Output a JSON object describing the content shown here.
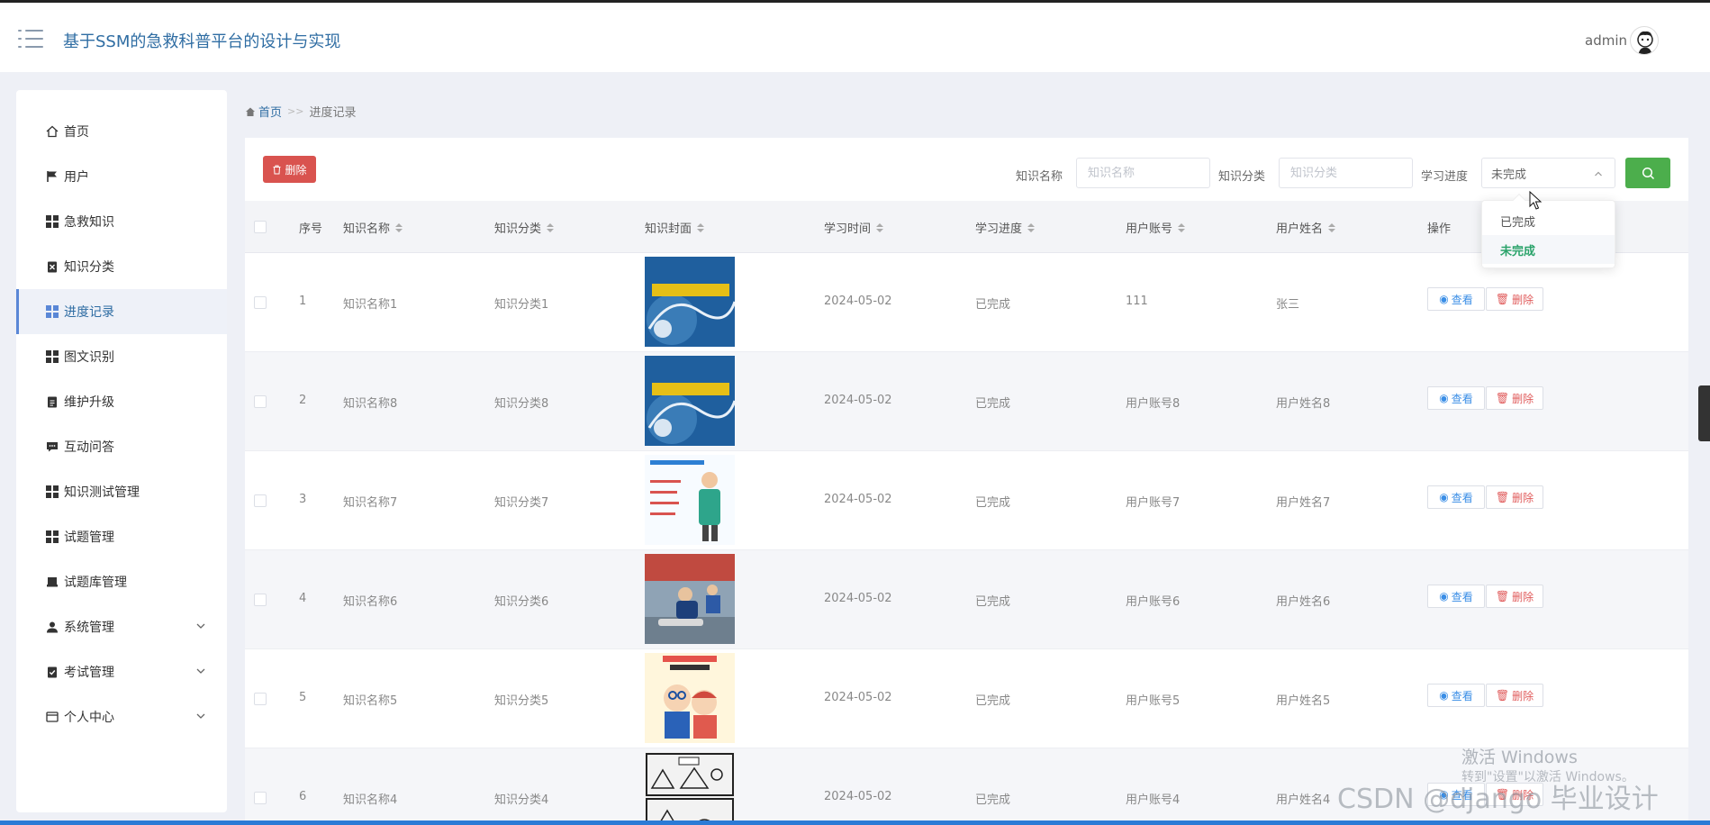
{
  "header": {
    "title": "基于SSM的急救科普平台的设计与实现",
    "user": "admin"
  },
  "sidebar": {
    "items": [
      {
        "label": "首页",
        "icon": "home-icon"
      },
      {
        "label": "用户",
        "icon": "flag-icon"
      },
      {
        "label": "急救知识",
        "icon": "grid-icon"
      },
      {
        "label": "知识分类",
        "icon": "clipboard-x-icon"
      },
      {
        "label": "进度记录",
        "icon": "grid-icon",
        "active": true
      },
      {
        "label": "图文识别",
        "icon": "grid-icon"
      },
      {
        "label": "维护升级",
        "icon": "clipboard-icon"
      },
      {
        "label": "互动问答",
        "icon": "chat-icon"
      },
      {
        "label": "知识测试管理",
        "icon": "grid-icon"
      },
      {
        "label": "试题管理",
        "icon": "grid-icon"
      },
      {
        "label": "试题库管理",
        "icon": "drive-icon"
      },
      {
        "label": "系统管理",
        "icon": "user-icon",
        "expandable": true
      },
      {
        "label": "考试管理",
        "icon": "clipboard-check-icon",
        "expandable": true
      },
      {
        "label": "个人中心",
        "icon": "window-icon",
        "expandable": true
      }
    ]
  },
  "breadcrumb": {
    "home": "首页",
    "separator": ">>",
    "current": "进度记录"
  },
  "toolbar": {
    "delete_label": "删除",
    "filters": {
      "name_label": "知识名称",
      "name_placeholder": "知识名称",
      "category_label": "知识分类",
      "category_placeholder": "知识分类",
      "progress_label": "学习进度",
      "progress_value": "未完成"
    },
    "dropdown_options": [
      "已完成",
      "未完成"
    ],
    "dropdown_selected": "未完成"
  },
  "table": {
    "columns": [
      "序号",
      "知识名称",
      "知识分类",
      "知识封面",
      "学习时间",
      "学习进度",
      "用户账号",
      "用户姓名",
      "操作"
    ],
    "view_label": "查看",
    "delete_label": "删除",
    "rows": [
      {
        "index": "1",
        "name": "知识名称1",
        "category": "知识分类1",
        "cover": "cover-first-aid-blue",
        "time": "2024-05-02",
        "progress": "已完成",
        "account": "111",
        "username": "张三"
      },
      {
        "index": "2",
        "name": "知识名称8",
        "category": "知识分类8",
        "cover": "cover-first-aid-blue",
        "time": "2024-05-02",
        "progress": "已完成",
        "account": "用户账号8",
        "username": "用户姓名8"
      },
      {
        "index": "3",
        "name": "知识名称7",
        "category": "知识分类7",
        "cover": "cover-poster-nurse",
        "time": "2024-05-02",
        "progress": "已完成",
        "account": "用户账号7",
        "username": "用户姓名7"
      },
      {
        "index": "4",
        "name": "知识名称6",
        "category": "知识分类6",
        "cover": "cover-cpr-training",
        "time": "2024-05-02",
        "progress": "已完成",
        "account": "用户账号6",
        "username": "用户姓名6"
      },
      {
        "index": "5",
        "name": "知识名称5",
        "category": "知识分类5",
        "cover": "cover-cartoon",
        "time": "2024-05-02",
        "progress": "已完成",
        "account": "用户账号5",
        "username": "用户姓名5"
      },
      {
        "index": "6",
        "name": "知识名称4",
        "category": "知识分类4",
        "cover": "cover-comic",
        "time": "2024-05-02",
        "progress": "已完成",
        "account": "用户账号4",
        "username": "用户姓名4"
      }
    ]
  },
  "overlay": {
    "activate_title": "激活 Windows",
    "activate_sub": "转到\"设置\"以激活 Windows。",
    "csdn": "CSDN @django 毕业设计"
  },
  "colors": {
    "accent": "#2f6da3",
    "danger": "#d9534f",
    "success": "#4cae4c",
    "selected_option": "#2aa36a"
  }
}
